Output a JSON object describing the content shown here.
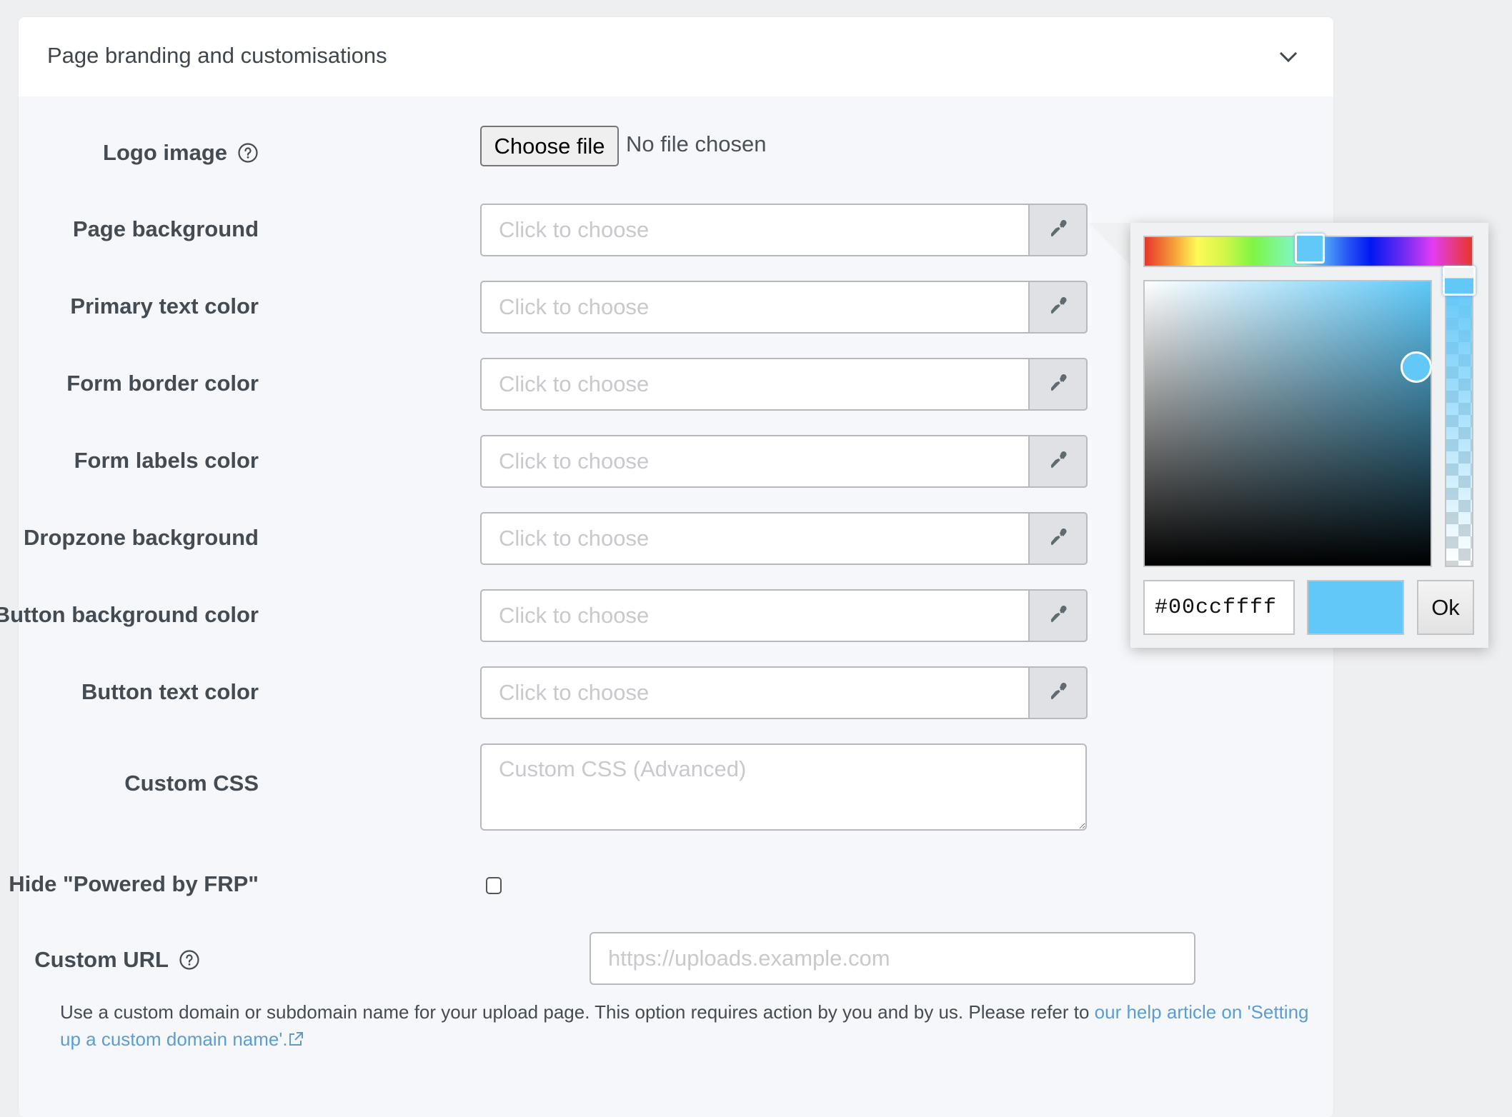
{
  "section": {
    "title": "Page branding and customisations",
    "collapse_icon": "chevron-down-icon"
  },
  "logo": {
    "label": "Logo image",
    "help_icon": "question-circle-icon",
    "choose_button": "Choose file",
    "status": "No file chosen"
  },
  "color_fields": [
    {
      "label": "Page background",
      "placeholder": "Click to choose",
      "value": ""
    },
    {
      "label": "Primary text color",
      "placeholder": "Click to choose",
      "value": ""
    },
    {
      "label": "Form border color",
      "placeholder": "Click to choose",
      "value": ""
    },
    {
      "label": "Form labels color",
      "placeholder": "Click to choose",
      "value": ""
    },
    {
      "label": "Dropzone background",
      "placeholder": "Click to choose",
      "value": ""
    },
    {
      "label": "Button background color",
      "placeholder": "Click to choose",
      "value": ""
    },
    {
      "label": "Button text color",
      "placeholder": "Click to choose",
      "value": ""
    }
  ],
  "picker_button_icon": "eyedropper-icon",
  "custom_css": {
    "label": "Custom CSS",
    "placeholder": "Custom CSS (Advanced)",
    "value": ""
  },
  "hide_powered_by": {
    "label": "Hide \"Powered by FRP\"",
    "checked": false
  },
  "custom_url": {
    "label": "Custom URL",
    "help_icon": "question-circle-icon",
    "placeholder": "https://uploads.example.com",
    "value": ""
  },
  "help_text": {
    "text": "Use a custom domain or subdomain name for your upload page. This option requires action by you and by us. Please refer to ",
    "link_label": "our help article on 'Setting up a custom domain name'.",
    "link_icon": "external-link-icon"
  },
  "color_picker": {
    "hex_value": "#00ccffff",
    "swatch_color": "#62c8f8",
    "hue_color": "#5ec8f8",
    "ok_label": "Ok"
  },
  "colors": {
    "link": "#5b9dd0",
    "label_text": "#444b52",
    "placeholder": "#c8c9cc"
  }
}
